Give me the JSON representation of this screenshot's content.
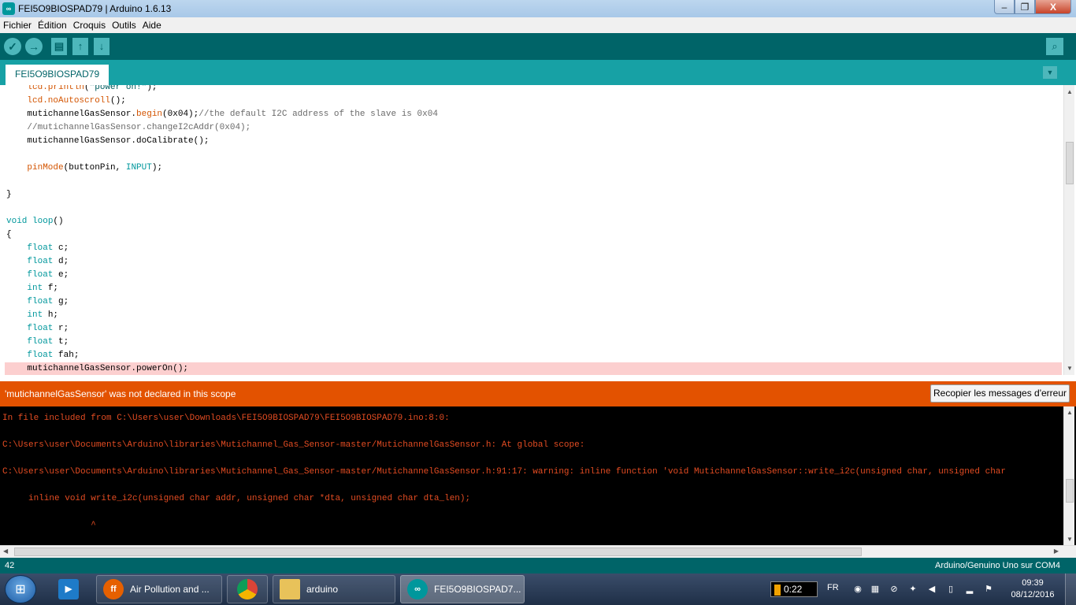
{
  "window": {
    "title": "FEI5O9BIOSPAD79 | Arduino 1.6.13",
    "min_label": "–",
    "max_label": "❐",
    "close_label": "X"
  },
  "menu": [
    "Fichier",
    "Édition",
    "Croquis",
    "Outils",
    "Aide"
  ],
  "toolbar": {
    "verify_glyph": "✓",
    "upload_glyph": "→",
    "new_glyph": "▤",
    "open_glyph": "↑",
    "save_glyph": "↓",
    "serial_glyph": "⌕"
  },
  "tab": {
    "label": "FEI5O9BIOSPAD79",
    "menu_glyph": "▼"
  },
  "editor": {
    "lines": [
      "    lcd.println(\"power on!\");",
      "    lcd.noAutoscroll();",
      "    mutichannelGasSensor.begin(0x04);//the default I2C address of the slave is 0x04",
      "    //mutichannelGasSensor.changeI2cAddr(0x04);",
      "    mutichannelGasSensor.doCalibrate();",
      "",
      "    pinMode(buttonPin, INPUT);",
      "",
      "}",
      "",
      "void loop()",
      "{",
      "    float c;",
      "    float d;",
      "    float e;",
      "    int f;",
      "    float g;",
      "    int h;",
      "    float r;",
      "    float t;",
      "    float fah;",
      "    mutichannelGasSensor.powerOn();"
    ]
  },
  "error": {
    "message": "'mutichannelGasSensor' was not declared in this scope",
    "copy_button": "Recopier les messages d'erreur"
  },
  "console": {
    "lines": [
      "In file included from C:\\Users\\user\\Downloads\\FEI5O9BIOSPAD79\\FEI5O9BIOSPAD79.ino:8:0:",
      "",
      "C:\\Users\\user\\Documents\\Arduino\\libraries\\Mutichannel_Gas_Sensor-master/MutichannelGasSensor.h: At global scope:",
      "",
      "C:\\Users\\user\\Documents\\Arduino\\libraries\\Mutichannel_Gas_Sensor-master/MutichannelGasSensor.h:91:17: warning: inline function 'void MutichannelGasSensor::write_i2c(unsigned char, unsigned char",
      "",
      "     inline void write_i2c(unsigned char addr, unsigned char *dta, unsigned char dta_len);",
      "",
      "                 ^"
    ]
  },
  "status": {
    "line_number": "42",
    "board": "Arduino/Genuino Uno sur COM4"
  },
  "taskbar": {
    "tasks": [
      {
        "label": "",
        "icon": "media-player-icon"
      },
      {
        "label": "Air Pollution and ...",
        "icon": "firefox-icon"
      },
      {
        "label": "",
        "icon": "chrome-icon"
      },
      {
        "label": "arduino",
        "icon": "folder-icon"
      },
      {
        "label": "FEI5O9BIOSPAD7...",
        "icon": "arduino-icon"
      }
    ],
    "timer": "0:22",
    "language": "FR",
    "time": "09:39",
    "date": "08/12/2016"
  },
  "colors": {
    "teal_dark": "#006468",
    "teal_light": "#17a1a5",
    "error_orange": "#e35200",
    "highlight_line": "#fccfcf",
    "console_text": "#e34c22"
  }
}
